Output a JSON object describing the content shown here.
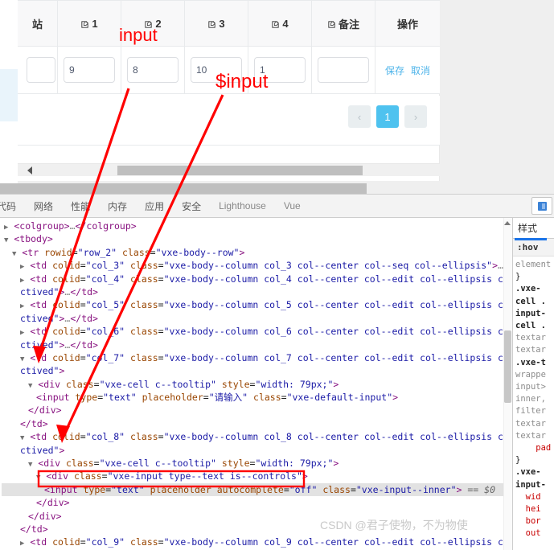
{
  "web_page": {
    "table": {
      "columns": [
        {
          "label": "站",
          "icon": null
        },
        {
          "label": "1",
          "icon": "edit-icon"
        },
        {
          "label": "2",
          "icon": "edit-icon"
        },
        {
          "label": "3",
          "icon": "edit-icon"
        },
        {
          "label": "4",
          "icon": "edit-icon"
        },
        {
          "label": "备注",
          "icon": "edit-icon"
        },
        {
          "label": "操作",
          "icon": null
        }
      ],
      "row": {
        "values": [
          "",
          "9",
          "8",
          "10",
          "1",
          ""
        ],
        "actions": [
          "保存",
          "取消"
        ]
      }
    },
    "pagination": {
      "prev": "‹",
      "current": "1",
      "next": "›",
      "active_color": "#4ec2ef"
    },
    "scrollbar": {
      "name": "horizontal-scrollbar"
    }
  },
  "annotations": {
    "label_input": "input",
    "label_dollar_input": "$input"
  },
  "devtools": {
    "tabs": [
      {
        "label": "代码",
        "active": false,
        "muted": false
      },
      {
        "label": "网络",
        "active": false,
        "muted": false
      },
      {
        "label": "性能",
        "active": false,
        "muted": false
      },
      {
        "label": "内存",
        "active": false,
        "muted": false
      },
      {
        "label": "应用",
        "active": false,
        "muted": false
      },
      {
        "label": "安全",
        "active": false,
        "muted": false
      },
      {
        "label": "Lighthouse",
        "active": false,
        "muted": true
      },
      {
        "label": "Vue",
        "active": false,
        "muted": true
      }
    ],
    "dom_lines": [
      {
        "id": "l0",
        "indent": 0,
        "arrow": "▶",
        "html": "<span class=\"tagc\">&lt;colgroup&gt;</span><span class=\"dim\">…</span><span class=\"tagc\">&lt;/colgroup&gt;</span>",
        "highlight": false
      },
      {
        "id": "l1",
        "indent": 0,
        "arrow": "▼",
        "html": "<span class=\"tagc\">&lt;tbody&gt;</span>",
        "highlight": false
      },
      {
        "id": "l2",
        "indent": 1,
        "arrow": "▼",
        "html": "<span class=\"tagc\">&lt;tr</span> <span class=\"attr\">rowid</span>=<span class=\"val\">\"row_2\"</span> <span class=\"attr\">class</span>=<span class=\"val\">\"vxe-body--row\"</span><span class=\"tagc\">&gt;</span>",
        "highlight": false
      },
      {
        "id": "l3",
        "indent": 2,
        "arrow": "▶",
        "html": "<span class=\"tagc\">&lt;td</span> <span class=\"attr\">colid</span>=<span class=\"val\">\"col_3\"</span> <span class=\"attr\">class</span>=<span class=\"val\">\"vxe-body--column col_3 col--center col--seq col--ellipsis\"</span><span class=\"tagc\">&gt;</span><span class=\"dim\">…</span><span class=\"tagc\">&lt;/td&gt;</span>",
        "highlight": false
      },
      {
        "id": "l4",
        "indent": 2,
        "arrow": "▶",
        "html": "<span class=\"tagc\">&lt;td</span> <span class=\"attr\">colid</span>=<span class=\"val\">\"col_4\"</span> <span class=\"attr\">class</span>=<span class=\"val\">\"vxe-body--column col_4 col--center col--edit col--ellipsis col--a</span>",
        "highlight": false
      },
      {
        "id": "l5",
        "indent": 2,
        "arrow": "",
        "html": "<span class=\"val\">ctived\"</span><span class=\"tagc\">&gt;</span><span class=\"dim\">…</span><span class=\"tagc\">&lt;/td&gt;</span>",
        "highlight": false
      },
      {
        "id": "l6",
        "indent": 2,
        "arrow": "▶",
        "html": "<span class=\"tagc\">&lt;td</span> <span class=\"attr\">colid</span>=<span class=\"val\">\"col_5\"</span> <span class=\"attr\">class</span>=<span class=\"val\">\"vxe-body--column col_5 col--center col--edit col--ellipsis col--a</span>",
        "highlight": false
      },
      {
        "id": "l7",
        "indent": 2,
        "arrow": "",
        "html": "<span class=\"val\">ctived\"</span><span class=\"tagc\">&gt;</span><span class=\"dim\">…</span><span class=\"tagc\">&lt;/td&gt;</span>",
        "highlight": false
      },
      {
        "id": "l8",
        "indent": 2,
        "arrow": "▶",
        "html": "<span class=\"tagc\">&lt;td</span> <span class=\"attr\">colid</span>=<span class=\"val\">\"col_6\"</span> <span class=\"attr\">class</span>=<span class=\"val\">\"vxe-body--column col_6 col--center col--edit col--ellipsis col--a</span>",
        "highlight": false
      },
      {
        "id": "l9",
        "indent": 2,
        "arrow": "",
        "html": "<span class=\"val\">ctived\"</span><span class=\"tagc\">&gt;</span><span class=\"dim\">…</span><span class=\"tagc\">&lt;/td&gt;</span>",
        "highlight": false
      },
      {
        "id": "l10",
        "indent": 2,
        "arrow": "▼",
        "html": "<span class=\"tagc\">&lt;td</span> <span class=\"attr\">colid</span>=<span class=\"val\">\"col_7\"</span> <span class=\"attr\">class</span>=<span class=\"val\">\"vxe-body--column col_7 col--center col--edit col--ellipsis col--a</span>",
        "highlight": false
      },
      {
        "id": "l11",
        "indent": 2,
        "arrow": "",
        "html": "<span class=\"val\">ctived\"</span><span class=\"tagc\">&gt;</span>",
        "highlight": false
      },
      {
        "id": "l12",
        "indent": 3,
        "arrow": "▼",
        "html": "<span class=\"tagc\">&lt;div</span> <span class=\"attr\">class</span>=<span class=\"val\">\"vxe-cell c--tooltip\"</span> <span class=\"attr\">style</span>=<span class=\"val\">\"width: 79px;\"</span><span class=\"tagc\">&gt;</span>",
        "highlight": false
      },
      {
        "id": "l13",
        "indent": 4,
        "arrow": "",
        "html": "<span class=\"tagc\">&lt;input</span> <span class=\"attr\">type</span>=<span class=\"val\">\"text\"</span> <span class=\"attr\">placeholder</span>=<span class=\"val\">\"请输入\"</span> <span class=\"attr\">class</span>=<span class=\"val\">\"vxe-default-input\"</span><span class=\"tagc\">&gt;</span>",
        "highlight": false
      },
      {
        "id": "l14",
        "indent": 3,
        "arrow": "",
        "html": "<span class=\"tagc\">&lt;/div&gt;</span>",
        "highlight": false
      },
      {
        "id": "l15",
        "indent": 2,
        "arrow": "",
        "html": "<span class=\"tagc\">&lt;/td&gt;</span>",
        "highlight": false
      },
      {
        "id": "l16",
        "indent": 2,
        "arrow": "▼",
        "html": "<span class=\"tagc\">&lt;td</span> <span class=\"attr\">colid</span>=<span class=\"val\">\"col_8\"</span> <span class=\"attr\">class</span>=<span class=\"val\">\"vxe-body--column col_8 col--center col--edit col--ellipsis col--a</span>",
        "highlight": false
      },
      {
        "id": "l17",
        "indent": 2,
        "arrow": "",
        "html": "<span class=\"val\">ctived\"</span><span class=\"tagc\">&gt;</span>",
        "highlight": false
      },
      {
        "id": "l18",
        "indent": 3,
        "arrow": "▼",
        "html": "<span class=\"tagc\">&lt;div</span> <span class=\"attr\">class</span>=<span class=\"val\">\"vxe-cell c--tooltip\"</span> <span class=\"attr\">style</span>=<span class=\"val\">\"width: 79px;\"</span><span class=\"tagc\">&gt;</span>",
        "highlight": false
      },
      {
        "id": "l19",
        "indent": 4,
        "arrow": "▼",
        "html": "<span class=\"tagc\">&lt;div</span> <span class=\"attr\">class</span>=<span class=\"val\">\"vxe-input type--text is--controls\"</span><span class=\"tagc\">&gt;</span>",
        "highlight": false,
        "boxed": true
      },
      {
        "id": "l20",
        "indent": 5,
        "arrow": "",
        "html": "<span class=\"tagc\">&lt;input</span> <span class=\"attr\">type</span>=<span class=\"val\">\"text\"</span> <span class=\"attr\">placeholder</span> <span class=\"attr\">autocomplete</span>=<span class=\"val\">\"off\"</span> <span class=\"attr\">class</span>=<span class=\"val\">\"vxe-input--inner\"</span><span class=\"tagc\">&gt;</span> <span class=\"dollar\">== $0</span>",
        "highlight": true
      },
      {
        "id": "l21",
        "indent": 4,
        "arrow": "",
        "html": "<span class=\"tagc\">&lt;/div&gt;</span>",
        "highlight": false
      },
      {
        "id": "l22",
        "indent": 3,
        "arrow": "",
        "html": "<span class=\"tagc\">&lt;/div&gt;</span>",
        "highlight": false
      },
      {
        "id": "l23",
        "indent": 2,
        "arrow": "",
        "html": "<span class=\"tagc\">&lt;/td&gt;</span>",
        "highlight": false
      },
      {
        "id": "l24",
        "indent": 2,
        "arrow": "▶",
        "html": "<span class=\"tagc\">&lt;td</span> <span class=\"attr\">colid</span>=<span class=\"val\">\"col_9\"</span> <span class=\"attr\">class</span>=<span class=\"val\">\"vxe-body--column col_9 col--center col--edit col--ellipsis col--a</span>",
        "highlight": false
      }
    ],
    "styles_panel": {
      "tab_label": "样式",
      "hov_label": ":hov",
      "lines": [
        "element",
        "}",
        ".vxe-",
        "cell .",
        "input-",
        "cell .",
        "textar",
        "textar",
        ".vxe-t",
        "wrappe",
        "input>",
        "inner,",
        "filter",
        "textar",
        "textar",
        "    pad",
        "}",
        ".vxe-",
        "input-",
        "  wid",
        "  hei",
        "  bor",
        "  out"
      ]
    }
  },
  "watermark": "CSDN @君子使物，不为物使"
}
